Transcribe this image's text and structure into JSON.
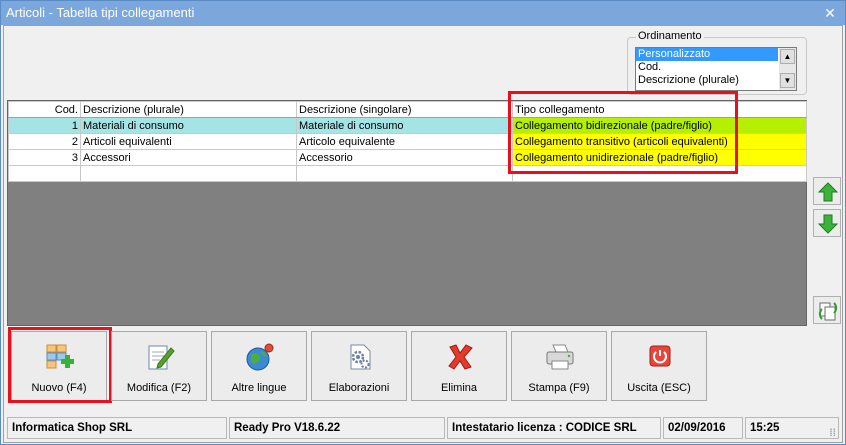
{
  "window": {
    "title": "Articoli - Tabella tipi collegamenti",
    "close": "✕"
  },
  "sort": {
    "label": "Ordinamento",
    "options": [
      "Personalizzato",
      "Cod.",
      "Descrizione (plurale)"
    ],
    "selected": "Personalizzato"
  },
  "grid": {
    "columns": [
      "Cod.",
      "Descrizione (plurale)",
      "Descrizione (singolare)",
      "Tipo collegamento"
    ],
    "rows": [
      {
        "cod": "1",
        "plurale": "Materiali di consumo",
        "singolare": "Materiale di consumo",
        "tipo": "Collegamento bidirezionale (padre/figlio)"
      },
      {
        "cod": "2",
        "plurale": "Articoli equivalenti",
        "singolare": "Articolo equivalente",
        "tipo": "Collegamento transitivo (articoli equivalenti)"
      },
      {
        "cod": "3",
        "plurale": "Accessori",
        "singolare": "Accessorio",
        "tipo": "Collegamento unidirezionale (padre/figlio)"
      }
    ]
  },
  "toolbar": {
    "nuovo": "Nuovo (F4)",
    "modifica": "Modifica (F2)",
    "lingue": "Altre lingue",
    "elaborazioni": "Elaborazioni",
    "elimina": "Elimina",
    "stampa": "Stampa (F9)",
    "uscita": "Uscita (ESC)"
  },
  "status": {
    "company": "Informatica Shop SRL",
    "version": "Ready Pro V18.6.22",
    "license": "Intestatario licenza : CODICE SRL",
    "date": "02/09/2016",
    "time": "15:25"
  },
  "colors": {
    "title_bar": "#7ba7dc",
    "selected_row": "#a4e4e4",
    "highlight_yellow": "#ffff00",
    "highlight_green": "#b4f000",
    "annotation_red": "#e8101c"
  }
}
